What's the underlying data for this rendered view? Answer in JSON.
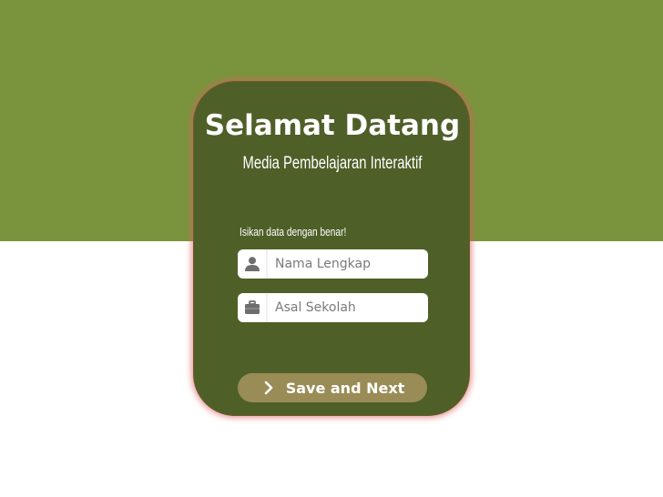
{
  "colors": {
    "top_band": "#7a943d",
    "card": "#4f5f28",
    "card_glow": "#db6060",
    "button": "#9a8c56",
    "field_bg": "#ffffff",
    "icon": "#6e6e6e"
  },
  "card": {
    "title": "Selamat Datang",
    "subtitle": "Media Pembelajaran Interaktif",
    "instruction": "Isikan data dengan benar!"
  },
  "form": {
    "name_field": {
      "icon": "user-icon",
      "placeholder": "Nama Lengkap",
      "value": ""
    },
    "school_field": {
      "icon": "briefcase-icon",
      "placeholder": "Asal Sekolah",
      "value": ""
    }
  },
  "save_button": {
    "icon": "chevron-right-icon",
    "label": "Save and Next"
  }
}
